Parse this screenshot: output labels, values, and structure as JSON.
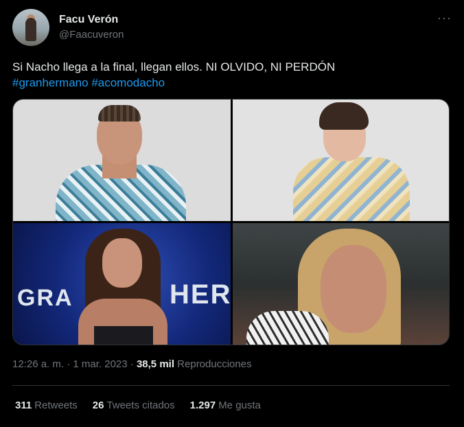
{
  "author": {
    "name": "Facu Verón",
    "handle": "@Faacuveron",
    "more_icon": "more-dots-icon"
  },
  "tweet": {
    "text": "Si Nacho llega a la final, llegan ellos. NI OLVIDO, NI PERDÓN",
    "hashtags": [
      "#granhermano",
      "#acomodacho"
    ]
  },
  "media": {
    "photo3_overlay_left": "GRA",
    "photo3_overlay_right": "HER"
  },
  "meta": {
    "time": "12:26 a. m.",
    "date": "1 mar. 2023",
    "separator": "·",
    "views_count": "38,5 mil",
    "views_label": "Reproducciones"
  },
  "stats": {
    "retweets_count": "311",
    "retweets_label": "Retweets",
    "quotes_count": "26",
    "quotes_label": "Tweets citados",
    "likes_count": "1.297",
    "likes_label": "Me gusta"
  },
  "colors": {
    "background": "#000000",
    "text": "#e7e9ea",
    "secondary": "#71767b",
    "link": "#1d9bf0",
    "border": "#2f3336"
  }
}
